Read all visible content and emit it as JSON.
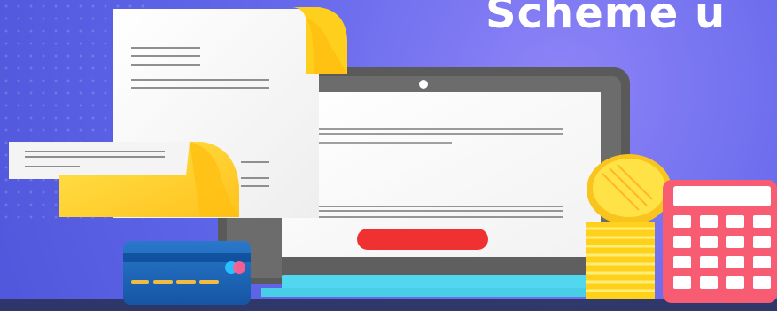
{
  "banner": {
    "title": "Scheme u"
  },
  "colors": {
    "background": "#5b63e6",
    "paper": "#f7f7f7",
    "laptop_frame": "#5a5a5a",
    "accent_red": "#ef3131",
    "gold": "#ffd623",
    "calculator_pink": "#f75c73",
    "card_blue": "#1e6bbf"
  },
  "icons": {
    "document": "document-icon",
    "laptop": "laptop-icon",
    "calculator": "calculator-icon",
    "credit_card": "credit-card-icon",
    "coin_stack": "coin-stack-icon"
  }
}
